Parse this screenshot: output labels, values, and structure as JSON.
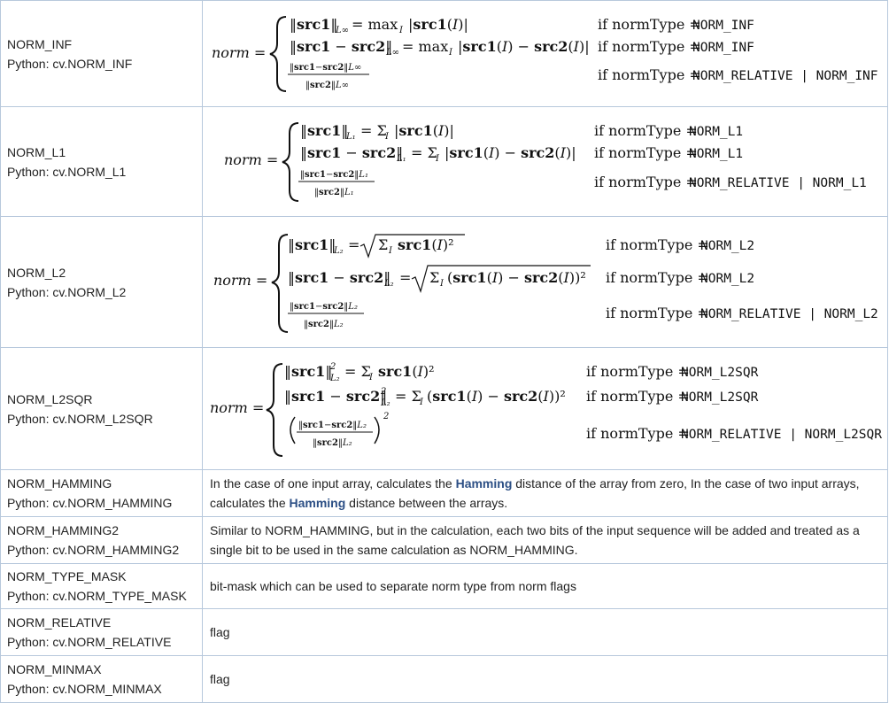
{
  "rows": [
    {
      "name": "NORM_INF",
      "python": "Python: cv.NORM_INF",
      "formula_lhs": "norm =",
      "cases": [
        {
          "expr": "‖src1‖L∞ = maxI |src1(I)|",
          "cond_prefix": "if normType =",
          "cond_value": "NORM_INF"
        },
        {
          "expr": "‖src1 − src2‖L∞ = maxI |src1(I) − src2(I)|",
          "cond_prefix": "if normType =",
          "cond_value": "NORM_INF"
        },
        {
          "expr": "‖src1−src2‖L∞ / ‖src2‖L∞",
          "cond_prefix": "if normType =",
          "cond_value": "NORM_RELATIVE | NORM_INF"
        }
      ]
    },
    {
      "name": "NORM_L1",
      "python": "Python: cv.NORM_L1",
      "formula_lhs": "norm =",
      "cases": [
        {
          "expr": "‖src1‖L1 = ΣI |src1(I)|",
          "cond_prefix": "if normType =",
          "cond_value": "NORM_L1"
        },
        {
          "expr": "‖src1 − src2‖L1 = ΣI |src1(I) − src2(I)|",
          "cond_prefix": "if normType =",
          "cond_value": "NORM_L1"
        },
        {
          "expr": "‖src1−src2‖L1 / ‖src2‖L1",
          "cond_prefix": "if normType =",
          "cond_value": "NORM_RELATIVE | NORM_L1"
        }
      ]
    },
    {
      "name": "NORM_L2",
      "python": "Python: cv.NORM_L2",
      "formula_lhs": "norm =",
      "cases": [
        {
          "expr": "‖src1‖L2 = √(ΣI src1(I)²)",
          "cond_prefix": "if normType =",
          "cond_value": "NORM_L2"
        },
        {
          "expr": "‖src1 − src2‖L2 = √(ΣI(src1(I) − src2(I))²)",
          "cond_prefix": "if normType =",
          "cond_value": "NORM_L2"
        },
        {
          "expr": "‖src1−src2‖L2 / ‖src2‖L2",
          "cond_prefix": "if normType =",
          "cond_value": "NORM_RELATIVE | NORM_L2"
        }
      ]
    },
    {
      "name": "NORM_L2SQR",
      "python": "Python: cv.NORM_L2SQR",
      "formula_lhs": "norm =",
      "cases": [
        {
          "expr": "‖src1‖²L2 = ΣI src1(I)²",
          "cond_prefix": "if normType =",
          "cond_value": "NORM_L2SQR"
        },
        {
          "expr": "‖src1 − src2‖²L2 = ΣI(src1(I) − src2(I))²",
          "cond_prefix": "if normType =",
          "cond_value": "NORM_L2SQR"
        },
        {
          "expr": "(‖src1−src2‖L2 / ‖src2‖L2)²",
          "cond_prefix": "if normType =",
          "cond_value": "NORM_RELATIVE | NORM_L2SQR"
        }
      ]
    },
    {
      "name": "NORM_HAMMING",
      "python": "Python: cv.NORM_HAMMING",
      "desc_parts": [
        "In the case of one input array, calculates the ",
        "Hamming",
        " distance of the array from zero, In the case of two input arrays, calculates the ",
        "Hamming",
        " distance between the arrays."
      ]
    },
    {
      "name": "NORM_HAMMING2",
      "python": "Python: cv.NORM_HAMMING2",
      "desc": "Similar to NORM_HAMMING, but in the calculation, each two bits of the input sequence will be added and treated as a single bit to be used in the same calculation as NORM_HAMMING."
    },
    {
      "name": "NORM_TYPE_MASK",
      "python": "Python: cv.NORM_TYPE_MASK",
      "desc": "bit-mask which can be used to separate norm type from norm flags"
    },
    {
      "name": "NORM_RELATIVE",
      "python": "Python: cv.NORM_RELATIVE",
      "desc": "flag"
    },
    {
      "name": "NORM_MINMAX",
      "python": "Python: cv.NORM_MINMAX",
      "desc": "flag"
    }
  ],
  "colors": {
    "border": "#b7c8dc",
    "keyword": "#2c4f85",
    "text": "#222222"
  }
}
